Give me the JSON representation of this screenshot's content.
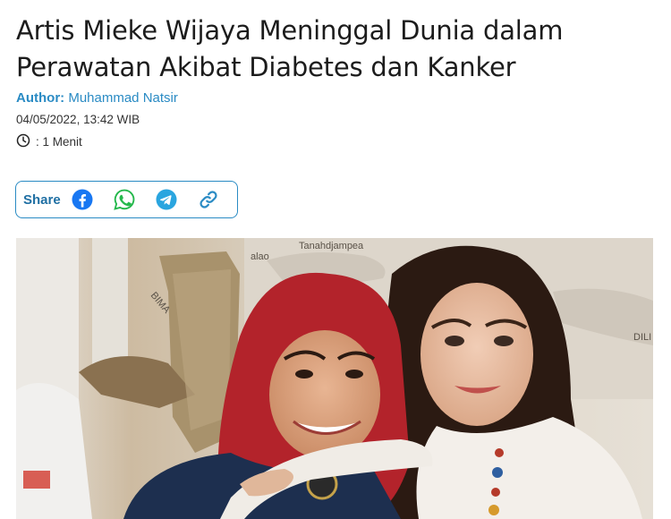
{
  "article": {
    "title": "Artis Mieke Wijaya Meninggal Dunia dalam Perawatan Akibat Diabetes dan Kanker",
    "author_label": "Author:",
    "author_name": "Muhammad Natsir",
    "date": "04/05/2022, 13:42 WIB",
    "read_time": ": 1 Menit"
  },
  "share": {
    "label": "Share",
    "buttons": [
      "facebook-icon",
      "whatsapp-icon",
      "telegram-icon",
      "link-icon"
    ]
  },
  "photo": {
    "map_text": [
      "Tanahdjampea",
      "alao",
      "BIMA",
      "DILI"
    ]
  },
  "colors": {
    "accent": "#2a8bc4",
    "facebook": "#1877f2",
    "whatsapp": "#25b84c",
    "telegram": "#2aa5df"
  }
}
